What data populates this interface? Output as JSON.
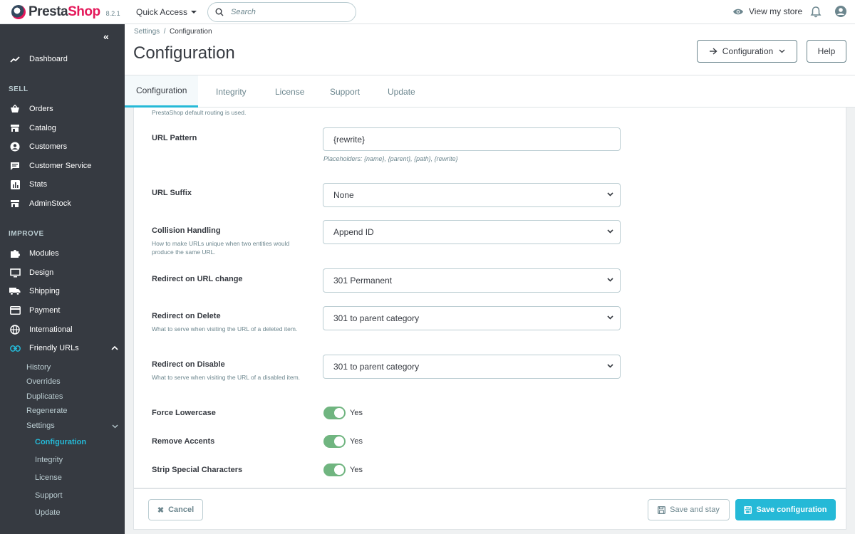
{
  "header": {
    "brand_pre": "Presta",
    "brand_post": "Shop",
    "version": "8.2.1",
    "quick_access": "Quick Access",
    "search_placeholder": "Search",
    "view_store": "View my store"
  },
  "sidebar": {
    "collapse": "«",
    "dashboard": "Dashboard",
    "section_sell": "SELL",
    "sell_items": [
      "Orders",
      "Catalog",
      "Customers",
      "Customer Service",
      "Stats",
      "AdminStock"
    ],
    "section_improve": "IMPROVE",
    "improve_items": [
      "Modules",
      "Design",
      "Shipping",
      "Payment",
      "International",
      "Friendly URLs"
    ],
    "friendly_sub": [
      "History",
      "Overrides",
      "Duplicates",
      "Regenerate",
      "Settings"
    ],
    "settings_sub": [
      "Configuration",
      "Integrity",
      "License",
      "Support",
      "Update"
    ]
  },
  "page": {
    "breadcrumb_parent": "Settings",
    "breadcrumb_sep": "/",
    "breadcrumb_current": "Configuration",
    "title": "Configuration",
    "config_button": "Configuration",
    "help_button": "Help"
  },
  "tabs": [
    "Configuration",
    "Integrity",
    "License",
    "Support",
    "Update"
  ],
  "form": {
    "top_note": "PrestaShop default routing is used.",
    "url_pattern": {
      "label": "URL Pattern",
      "value": "{rewrite}",
      "placeholders": "Placeholders: {name}, {parent}, {path}, {rewrite}"
    },
    "url_suffix": {
      "label": "URL Suffix",
      "value": "None"
    },
    "collision": {
      "label": "Collision Handling",
      "help": "How to make URLs unique when two entities would produce the same URL.",
      "value": "Append ID"
    },
    "redirect_change": {
      "label": "Redirect on URL change",
      "value": "301 Permanent"
    },
    "redirect_delete": {
      "label": "Redirect on Delete",
      "help": "What to serve when visiting the URL of a deleted item.",
      "value": "301 to parent category"
    },
    "redirect_disable": {
      "label": "Redirect on Disable",
      "help": "What to serve when visiting the URL of a disabled item.",
      "value": "301 to parent category"
    },
    "force_lowercase": {
      "label": "Force Lowercase",
      "state": "Yes",
      "on": true
    },
    "remove_accents": {
      "label": "Remove Accents",
      "state": "Yes",
      "on": true
    },
    "strip_special": {
      "label": "Strip Special Characters",
      "state": "Yes",
      "on": true
    }
  },
  "footer": {
    "cancel": "Cancel",
    "save_stay": "Save and stay",
    "save_config": "Save configuration"
  },
  "colors": {
    "accent": "#25b9d7",
    "brand": "#e4185a",
    "sidebar": "#363a41",
    "toggle_on": "#70b580"
  }
}
